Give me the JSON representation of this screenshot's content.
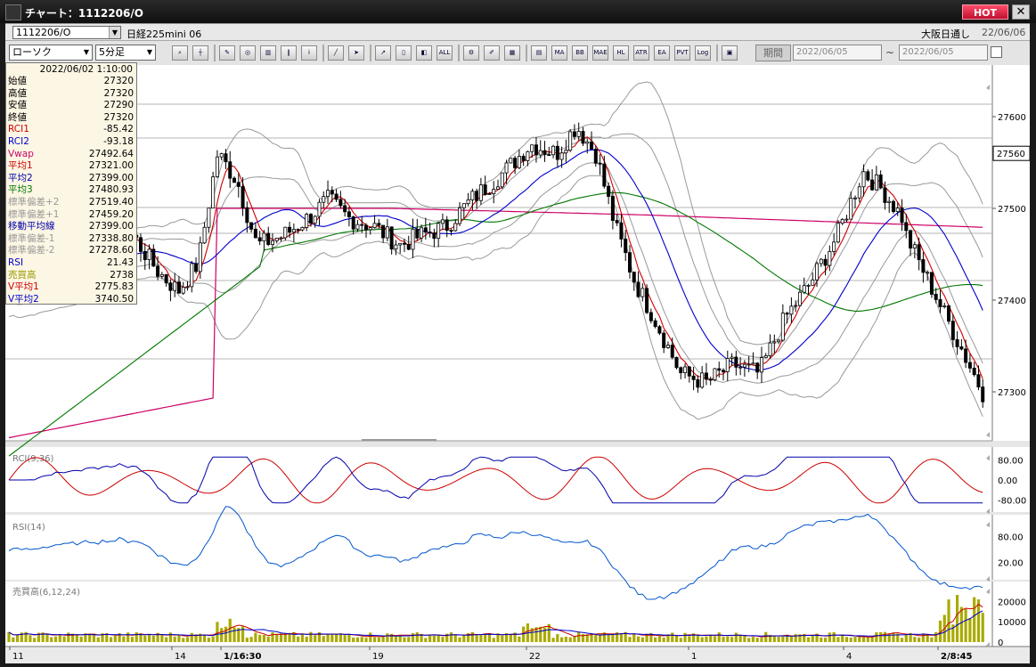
{
  "window": {
    "title": "チャート：1112206/O",
    "hot_label": "HOT",
    "close_label": "✕"
  },
  "symbol_bar": {
    "code": "1112206/O",
    "name": "日経225mini 06",
    "market": "大阪日通し",
    "date": "22/06/06"
  },
  "toolbar": {
    "chart_type": "ローソク",
    "interval": "5分足",
    "period_label": "期間",
    "date_from": "2022/06/05",
    "date_to": "2022/06/05",
    "tilde": "~",
    "icons": [
      "zoom-icon",
      "crosshair-icon",
      "drawing-icon",
      "search-chart-icon",
      "compare-icon",
      "bars-icon",
      "info-icon",
      "trendline-icon",
      "cursor-icon",
      "pointer-icon",
      "candle-icon",
      "split-icon",
      "all-icon",
      "gear-icon",
      "pen-icon",
      "palette-icon",
      "volume-icon",
      "ma-icon",
      "bb-icon",
      "mae-icon",
      "hl-icon",
      "atr-icon",
      "ea-icon",
      "pvt-icon",
      "log-icon",
      "screen-icon"
    ],
    "icon_labels": {
      "all": "ALL",
      "ma": "MA",
      "bb": "BB",
      "mae": "MAE",
      "hl": "HL",
      "atr": "ATR",
      "ea": "EA",
      "pvt": "PVT",
      "log": "Log"
    }
  },
  "info_panel": {
    "datetime": "2022/06/02 1:10:00",
    "rows": [
      {
        "label": "始値",
        "value": "27320",
        "color": "#000000"
      },
      {
        "label": "高値",
        "value": "27320",
        "color": "#000000"
      },
      {
        "label": "安値",
        "value": "27290",
        "color": "#000000"
      },
      {
        "label": "終値",
        "value": "27320",
        "color": "#000000"
      },
      {
        "label": "RCI1",
        "value": "-85.42",
        "color": "#cc0000"
      },
      {
        "label": "RCI2",
        "value": "-93.18",
        "color": "#0000cc"
      },
      {
        "label": "Vwap",
        "value": "27492.64",
        "color": "#cc0066"
      },
      {
        "label": "平均1",
        "value": "27321.00",
        "color": "#cc0000"
      },
      {
        "label": "平均2",
        "value": "27399.00",
        "color": "#0000aa"
      },
      {
        "label": "平均3",
        "value": "27480.93",
        "color": "#007700"
      },
      {
        "label": "標準偏差+2",
        "value": "27519.40",
        "color": "#999999"
      },
      {
        "label": "標準偏差+1",
        "value": "27459.20",
        "color": "#999999"
      },
      {
        "label": "移動平均線",
        "value": "27399.00",
        "color": "#0000aa"
      },
      {
        "label": "標準偏差-1",
        "value": "27338.80",
        "color": "#999999"
      },
      {
        "label": "標準偏差-2",
        "value": "27278.60",
        "color": "#999999"
      },
      {
        "label": "RSI",
        "value": "21.43",
        "color": "#0000cc"
      },
      {
        "label": "売買高",
        "value": "2738",
        "color": "#999900"
      },
      {
        "label": "V平均1",
        "value": "2775.83",
        "color": "#cc0000"
      },
      {
        "label": "V平均2",
        "value": "3740.50",
        "color": "#0000cc"
      }
    ]
  },
  "main_chart": {
    "y_ticks": [
      "27600",
      "27500",
      "27400",
      "27300"
    ],
    "current_price": "27560"
  },
  "rci_panel": {
    "label": "RCI(9,36)",
    "y_ticks": [
      "80.00",
      "0.00",
      "-80.00"
    ]
  },
  "rsi_panel": {
    "label": "RSI(14)",
    "y_ticks": [
      "80.00",
      "20.00"
    ]
  },
  "volume_panel": {
    "label": "売買高(6,12,24)",
    "y_ticks": [
      "20000",
      "10000",
      "0"
    ]
  },
  "x_axis": {
    "labels": [
      "11",
      "14",
      "1/16:30",
      "19",
      "22",
      "1",
      "4",
      "2/8:45"
    ]
  },
  "colors": {
    "candle": "#000000",
    "ma_short": "#cc0000",
    "ma_mid": "#0000cc",
    "ma_long": "#007700",
    "vwap": "#cc0066",
    "bands": "#999999",
    "volume": "#aaaa00"
  }
}
